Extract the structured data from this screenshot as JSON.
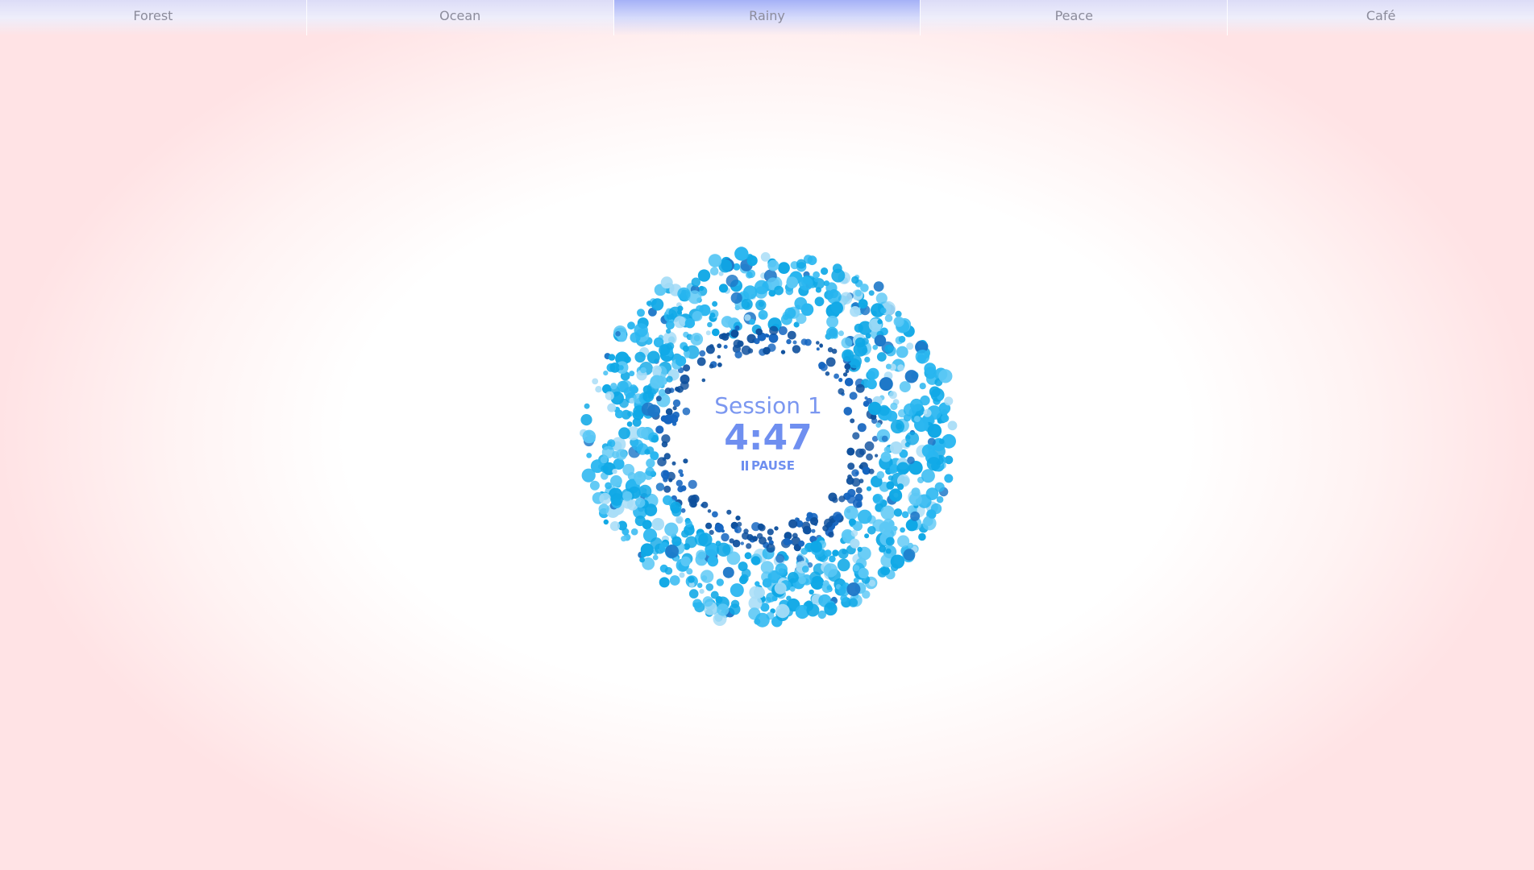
{
  "tabs": [
    {
      "label": "Forest",
      "active": false
    },
    {
      "label": "Ocean",
      "active": false
    },
    {
      "label": "Rainy",
      "active": true
    },
    {
      "label": "Peace",
      "active": false
    },
    {
      "label": "Café",
      "active": false
    }
  ],
  "timer": {
    "session_label": "Session 1",
    "time": "4:47",
    "pause_label": "PAUSE",
    "pause_icon": "pause-icon"
  },
  "visual": {
    "name": "particle-ring",
    "colors": [
      "#0fa8e6",
      "#29b6f0",
      "#5cc8f5",
      "#a8ddf7",
      "#1e78c8",
      "#0d4f9c",
      "#1565c0"
    ]
  }
}
